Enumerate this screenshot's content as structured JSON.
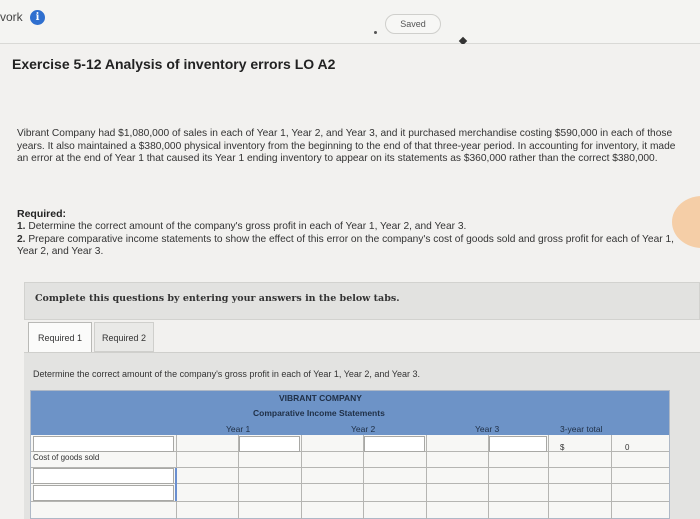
{
  "topbar": {
    "brand": "vork",
    "saved_label": "Saved"
  },
  "exercise": {
    "title": "Exercise 5-12 Analysis of inventory errors LO A2",
    "problem": "Vibrant Company had $1,080,000 of sales in each of Year 1, Year 2, and Year 3, and it purchased merchandise costing $590,000 in each of those years. It also maintained a $380,000 physical inventory from the beginning to the end of that three-year period. In accounting for inventory, it made an error at the end of Year 1 that caused its Year 1 ending inventory to appear on its statements as $360,000 rather than the correct $380,000."
  },
  "required": {
    "heading": "Required:",
    "item1_num": "1.",
    "item1": "Determine the correct amount of the company's gross profit in each of Year 1, Year 2, and Year 3.",
    "item2_num": "2.",
    "item2": "Prepare comparative income statements to show the effect of this error on the company's cost of goods sold and gross profit for each of Year 1, Year 2, and Year 3."
  },
  "instruction": "Complete this questions by entering your answers in the below tabs.",
  "tabs": [
    {
      "label": "Required 1"
    },
    {
      "label": "Required 2"
    }
  ],
  "panel": {
    "instruction": "Determine the correct amount of the company's gross profit in each of Year 1, Year 2, and Year 3."
  },
  "table": {
    "company": "VIBRANT COMPANY",
    "statement": "Comparative Income Statements",
    "columns": [
      "Year 1",
      "Year 2",
      "Year 3",
      "3-year total"
    ],
    "rows": [
      {
        "label": ""
      },
      {
        "label": "Cost of goods sold"
      },
      {
        "label": ""
      },
      {
        "label": ""
      }
    ],
    "total_currency": "$",
    "total_value": "0"
  }
}
